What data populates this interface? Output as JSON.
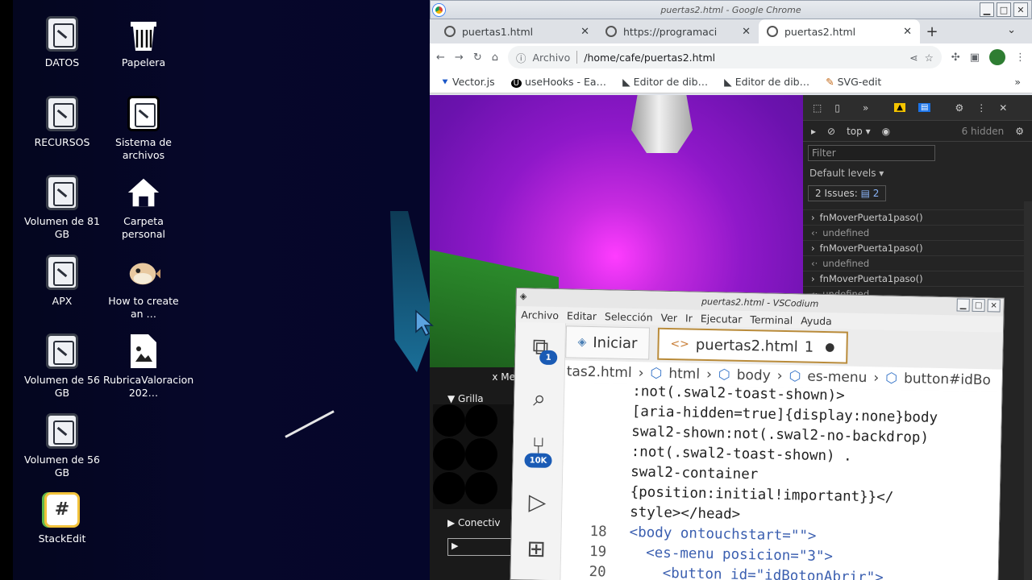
{
  "desktop": {
    "icons": [
      {
        "label": "DATOS",
        "icon": "drive-icon"
      },
      {
        "label": "Papelera",
        "icon": "trash-icon"
      },
      {
        "label": "RECURSOS",
        "icon": "drive-icon"
      },
      {
        "label": "Sistema de archivos",
        "icon": "drive-icon"
      },
      {
        "label": "Volumen de 81 GB",
        "icon": "drive-icon"
      },
      {
        "label": "Carpeta personal",
        "icon": "home-icon"
      },
      {
        "label": "APX",
        "icon": "drive-icon"
      },
      {
        "label": "How to create an …",
        "icon": "pufferfish-icon"
      },
      {
        "label": "Volumen de 56 GB",
        "icon": "drive-icon"
      },
      {
        "label": "RubricaValoracion 202…",
        "icon": "document-icon"
      },
      {
        "label": "Volumen de 56 GB",
        "icon": "drive-icon"
      },
      {
        "label": "StackEdit",
        "icon": "stackedit-icon"
      }
    ]
  },
  "chrome": {
    "window_title": "puertas2.html - Google Chrome",
    "tabs": [
      {
        "label": "puertas1.html"
      },
      {
        "label": "https://programaci"
      },
      {
        "label": "puertas2.html"
      }
    ],
    "omnibox": {
      "scheme_label": "Archivo",
      "url": "/home/cafe/puertas2.html"
    },
    "bookmarks": [
      {
        "label": "Vector.js"
      },
      {
        "label": "useHooks - Ea…"
      },
      {
        "label": "Editor de dib…"
      },
      {
        "label": "Editor de dib…"
      },
      {
        "label": "SVG-edit"
      }
    ]
  },
  "page": {
    "gui_title": "x Me",
    "grilla": "Grilla",
    "conectividad": "Conectiv"
  },
  "devtools": {
    "context": "top",
    "hidden_count": "6 hidden",
    "filter_placeholder": "Filter",
    "levels": "Default levels",
    "issues": "2 Issues:",
    "issues_count": "2",
    "console": [
      {
        "kind": "call",
        "text": "fnMoverPuerta1paso()"
      },
      {
        "kind": "result",
        "text": "undefined"
      },
      {
        "kind": "call",
        "text": "fnMoverPuerta1paso()"
      },
      {
        "kind": "result",
        "text": "undefined"
      },
      {
        "kind": "call",
        "text": "fnMoverPuerta1paso()"
      },
      {
        "kind": "result",
        "text": "undefined"
      }
    ]
  },
  "vscode": {
    "window_title": "puertas2.html - VSCodium",
    "menu": [
      "Archivo",
      "Editar",
      "Selección",
      "Ver",
      "Ir",
      "Ejecutar",
      "Terminal",
      "Ayuda"
    ],
    "tabs": [
      {
        "label": "Iniciar"
      },
      {
        "label": "puertas2.html",
        "problems": "1"
      }
    ],
    "explorer_badge": "1",
    "scm_badge": "10K",
    "breadcrumb": [
      "tas2.html",
      "html",
      "body",
      "es-menu",
      "button#idBo"
    ],
    "lines": [
      {
        "n": "",
        "text": ":not(.swal2-toast-shown)>"
      },
      {
        "n": "",
        "text": "[aria-hidden=true]{display:none}body"
      },
      {
        "n": "",
        "text": "swal2-shown:not(.swal2-no-backdrop)"
      },
      {
        "n": "",
        "text": ":not(.swal2-toast-shown) ."
      },
      {
        "n": "",
        "text": "swal2-container"
      },
      {
        "n": "",
        "text": "{position:initial!important}}</"
      },
      {
        "n": "",
        "text": "style></head>"
      },
      {
        "n": "18",
        "text": "<body ontouchstart=\"\">"
      },
      {
        "n": "19",
        "text": "  <es-menu posicion=\"3\">"
      },
      {
        "n": "20",
        "text": "    <button id=\"idBotonAbrir\">"
      }
    ]
  }
}
